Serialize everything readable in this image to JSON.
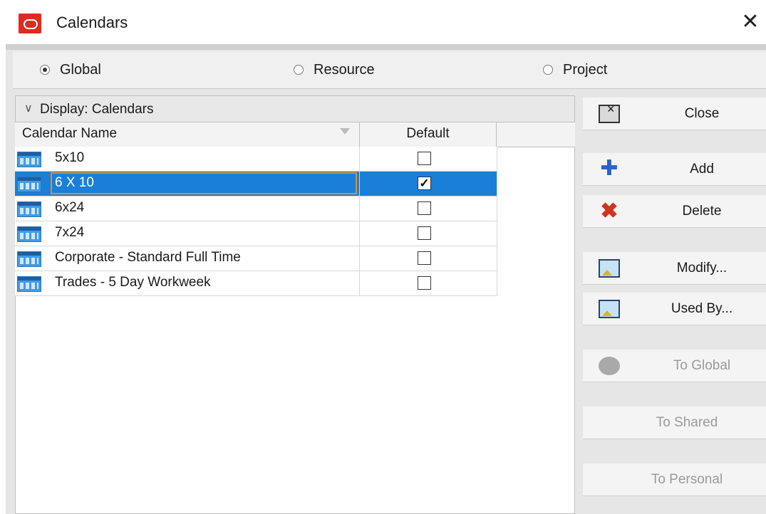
{
  "window": {
    "title": "Calendars",
    "close_glyph": "✕"
  },
  "scope": {
    "options": [
      {
        "label": "Global",
        "selected": true
      },
      {
        "label": "Resource",
        "selected": false
      },
      {
        "label": "Project",
        "selected": false
      }
    ]
  },
  "display": {
    "label": "Display: Calendars"
  },
  "table": {
    "columns": {
      "name": "Calendar Name",
      "default": "Default"
    },
    "rows": [
      {
        "name": "5x10",
        "default": false,
        "selected": false
      },
      {
        "name": "6 X 10",
        "default": true,
        "selected": true
      },
      {
        "name": "6x24",
        "default": false,
        "selected": false
      },
      {
        "name": "7x24",
        "default": false,
        "selected": false
      },
      {
        "name": "Corporate - Standard Full Time",
        "default": false,
        "selected": false
      },
      {
        "name": "Trades -  5 Day Workweek",
        "default": false,
        "selected": false
      }
    ],
    "check_glyph": "✓"
  },
  "actions": {
    "close": "Close",
    "add": "Add",
    "delete": "Delete",
    "modify": "Modify...",
    "used_by": "Used By...",
    "to_global": "To Global",
    "to_shared": "To Shared",
    "to_personal": "To Personal"
  },
  "icons": {
    "add_glyph": "✚",
    "delete_glyph": "✖"
  },
  "colors": {
    "selection": "#1a7fd8",
    "focus_outline": "#e98a2b",
    "app_logo": "#e02a1e"
  }
}
